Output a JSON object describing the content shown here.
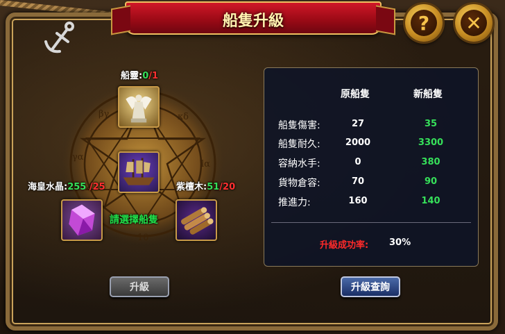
{
  "title": "船隻升級",
  "buttons": {
    "help": "?",
    "close": "✕",
    "upgrade": "升級",
    "query": "升級查詢"
  },
  "icons": {
    "help": "question-icon",
    "close": "close-icon",
    "anchor": "anchor-icon"
  },
  "materials": {
    "spirit": {
      "name": "船靈:",
      "have": "0",
      "sep": "/",
      "need": "1",
      "icon": "angel-statue-icon"
    },
    "crystal": {
      "name": "海皇水晶:",
      "have": "255",
      "sep": " ",
      "need": "/25",
      "icon": "purple-crystal-icon"
    },
    "wood": {
      "name": "紫檀木:",
      "have": "51",
      "sep": "/",
      "need": "20",
      "icon": "wood-logs-icon"
    },
    "ship": {
      "icon": "ship-icon"
    }
  },
  "hint": "請選擇船隻",
  "stats": {
    "headers": {
      "old": "原船隻",
      "new": "新船隻"
    },
    "rows": [
      {
        "label": "船隻傷害:",
        "old": "27",
        "new": "35"
      },
      {
        "label": "船隻耐久:",
        "old": "2000",
        "new": "3300"
      },
      {
        "label": "容納水手:",
        "old": "0",
        "new": "380"
      },
      {
        "label": "貨物倉容:",
        "old": "70",
        "new": "90"
      },
      {
        "label": "推進力:",
        "old": "160",
        "new": "140"
      }
    ],
    "success_rate_label": "升級成功率:",
    "success_rate": "30%"
  },
  "circle_runes": [
    "ξ",
    "κδ",
    "βγ",
    "γα",
    "lα",
    "10"
  ],
  "colors": {
    "have": "#36e05a",
    "need": "#ff3030",
    "banner": "#c01020",
    "panel": "#0e1426"
  }
}
